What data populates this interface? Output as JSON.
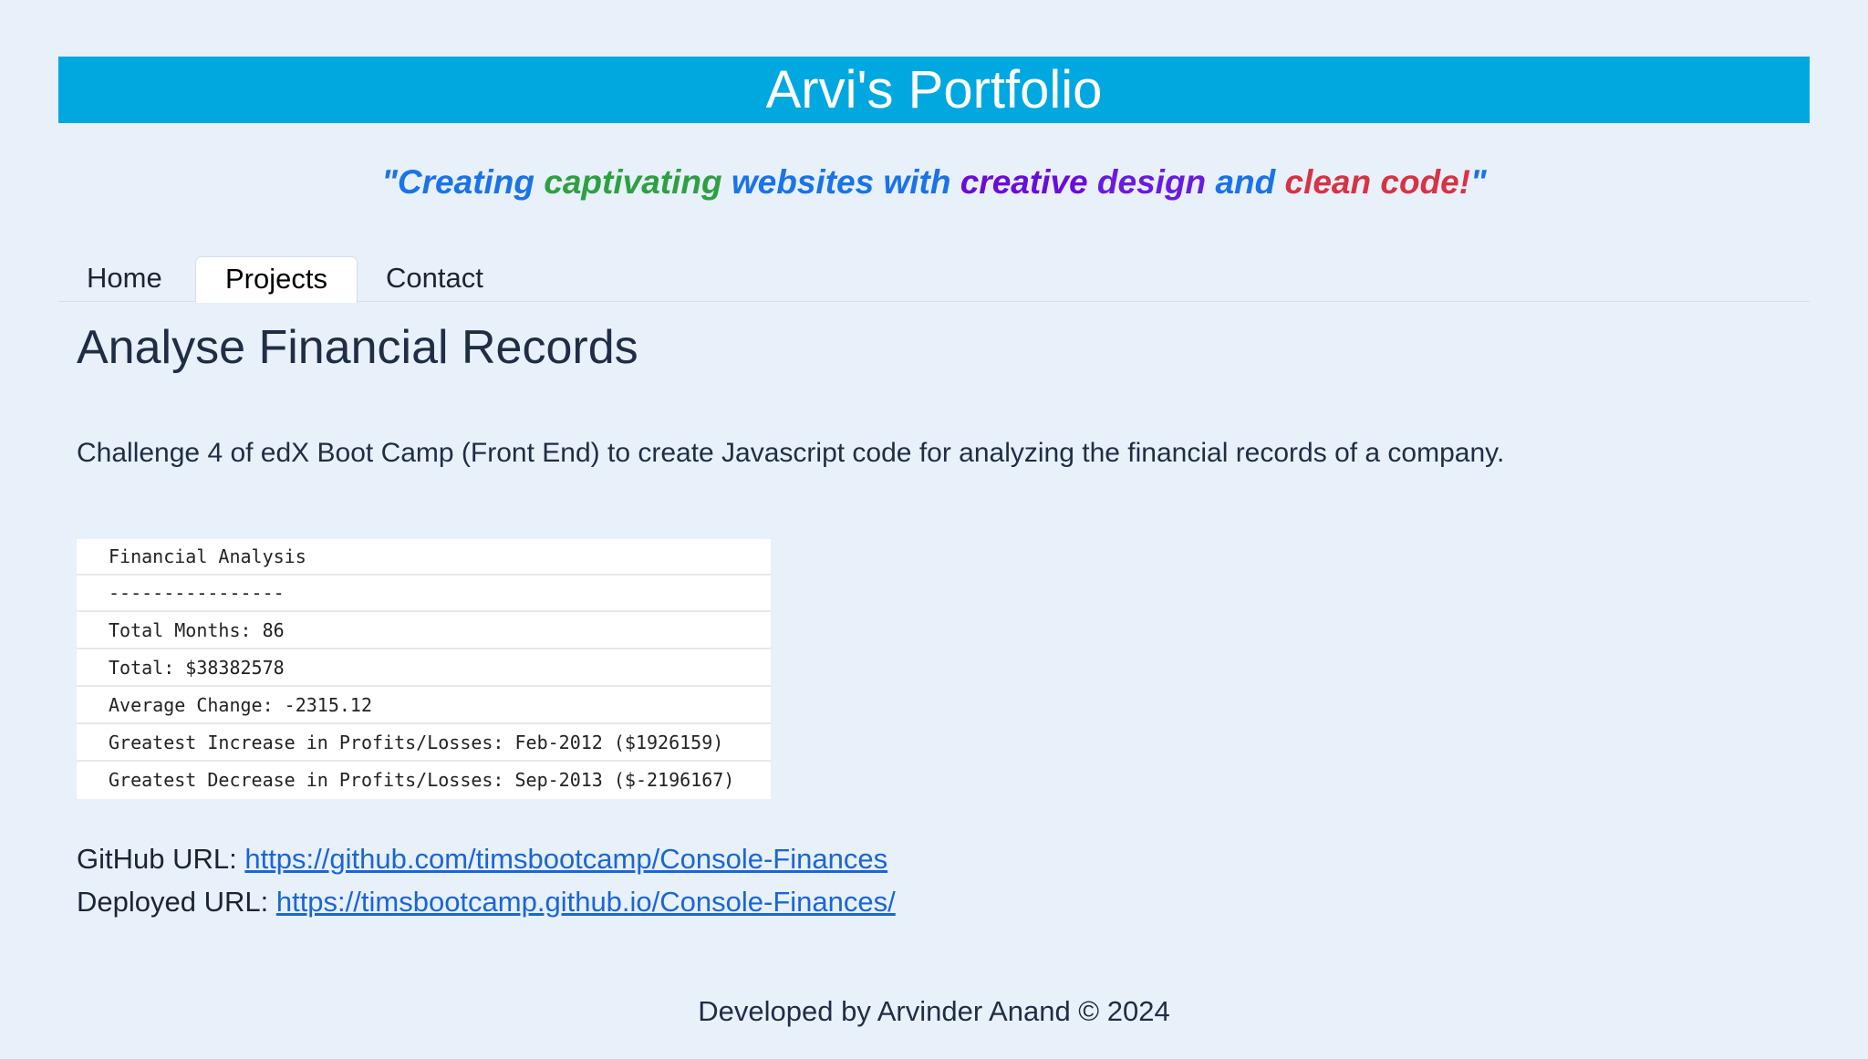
{
  "header": {
    "title": "Arvi's Portfolio",
    "tagline": [
      {
        "text": "\"Creating ",
        "color": "#1a73e8"
      },
      {
        "text": "captivating ",
        "color": "#2ea043"
      },
      {
        "text": "websites with ",
        "color": "#1a73e8"
      },
      {
        "text": "creative ",
        "color": "#6a0dd8"
      },
      {
        "text": "design ",
        "color": "#6a1be0"
      },
      {
        "text": "and ",
        "color": "#1a73e8"
      },
      {
        "text": "clean code!",
        "color": "#d63344"
      },
      {
        "text": "\"",
        "color": "#1a73e8"
      }
    ]
  },
  "nav": {
    "tabs": [
      {
        "label": "Home"
      },
      {
        "label": "Projects",
        "active": true
      },
      {
        "label": "Contact"
      }
    ]
  },
  "project": {
    "title": "Analyse Financial Records",
    "description": "Challenge 4 of edX Boot Camp (Front End) to create Javascript code for analyzing the financial records of a company.",
    "console_lines": [
      "Financial Analysis",
      "----------------",
      "Total Months: 86",
      "Total: $38382578",
      "Average Change: -2315.12",
      "Greatest Increase in Profits/Losses: Feb-2012 ($1926159)",
      "Greatest Decrease in Profits/Losses: Sep-2013 ($-2196167)"
    ],
    "github_label": "GitHub URL: ",
    "github_url": "https://github.com/timsbootcamp/Console-Finances",
    "deployed_label": "Deployed URL: ",
    "deployed_url": "https://timsbootcamp.github.io/Console-Finances/"
  },
  "footer": {
    "text": "Developed by Arvinder Anand © 2024"
  },
  "colors": {
    "background": "#e8f0f9",
    "banner": "#00a8e0",
    "link": "#1a66d6"
  }
}
